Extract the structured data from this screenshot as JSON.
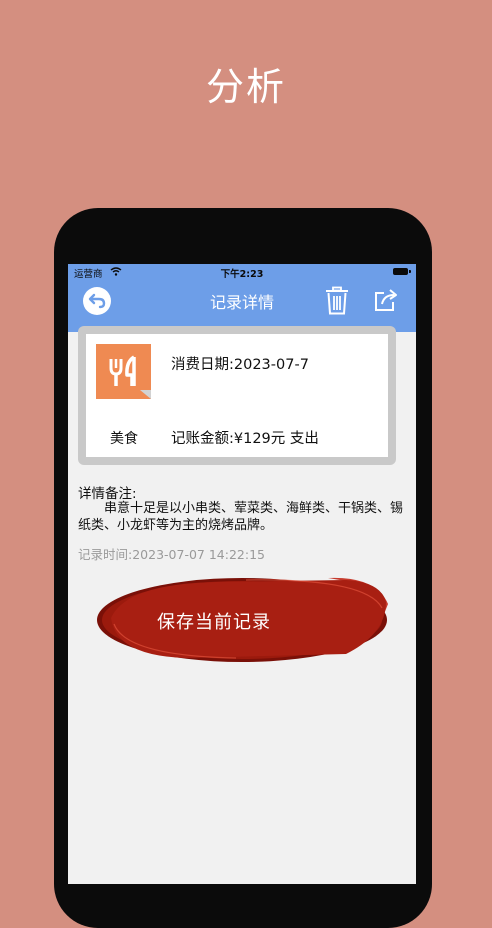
{
  "promo": {
    "title": "分析"
  },
  "status_bar": {
    "carrier": "运营商",
    "time": "下午2:23"
  },
  "nav": {
    "title": "记录详情",
    "back_icon": "back-arrow-icon",
    "delete_icon": "trash-icon",
    "share_icon": "share-icon"
  },
  "record": {
    "category": "美食",
    "category_icon": "fork-knife-icon",
    "date": "消费日期:2023-07-7",
    "amount": "记账金额:¥129元 支出"
  },
  "notes": {
    "heading": "详情备注:",
    "text": "串意十足是以小串类、荤菜类、海鲜类、干锅类、锡纸类、小龙虾等为主的烧烤品牌。"
  },
  "record_time": "记录时间:2023-07-07 14:22:15",
  "save_button": {
    "label": "保存当前记录"
  },
  "colors": {
    "background": "#d48f80",
    "nav": "#6d9ee8",
    "category": "#ef8a52",
    "button": "#9b1a0d"
  }
}
